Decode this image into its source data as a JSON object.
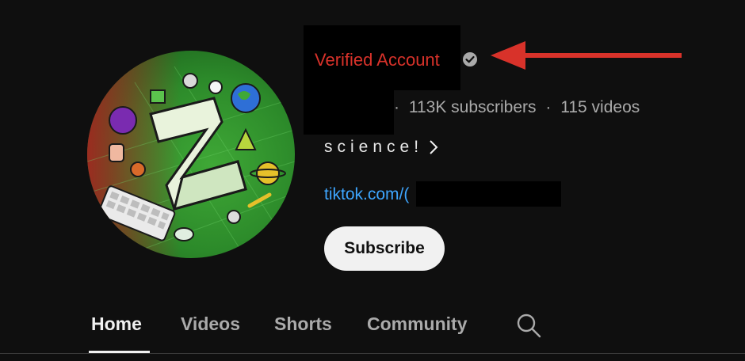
{
  "channel": {
    "verified_label": "Verified Account",
    "subscribers": "113K subscribers",
    "videos": "115 videos",
    "separator": "·",
    "description": "science!",
    "link_prefix": "tiktok.com/(",
    "subscribe_label": "Subscribe"
  },
  "tabs": [
    {
      "label": "Home",
      "active": true
    },
    {
      "label": "Videos",
      "active": false
    },
    {
      "label": "Shorts",
      "active": false
    },
    {
      "label": "Community",
      "active": false
    }
  ],
  "icons": {
    "verified": "checkmark-circle-icon",
    "more": "chevron-right-icon",
    "search": "search-icon",
    "annotation": "red-arrow"
  },
  "colors": {
    "annotation": "#d8322a",
    "link": "#3ea6ff",
    "background": "#0f0f0f"
  }
}
